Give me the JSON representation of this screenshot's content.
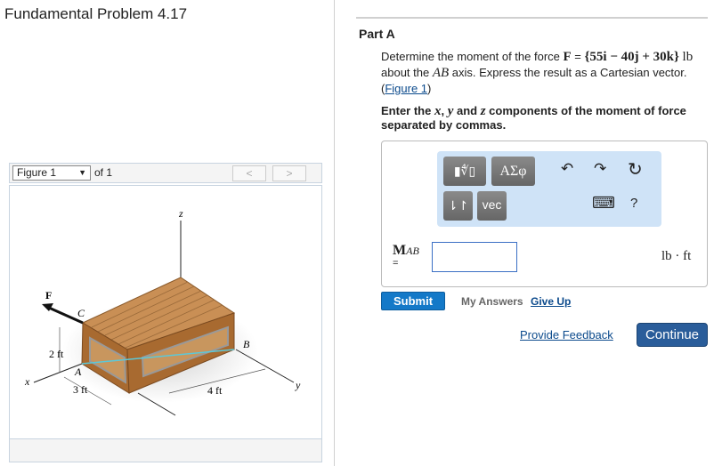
{
  "title": "Fundamental Problem 4.17",
  "figure": {
    "selected": "Figure 1",
    "of": "of 1",
    "prev": "<",
    "next": ">",
    "labels": {
      "z": "z",
      "x": "x",
      "y": "y",
      "F": "F",
      "C": "C",
      "A": "A",
      "B": "B",
      "h": "2 ft",
      "w": "3 ft",
      "l": "4 ft"
    }
  },
  "part": {
    "title": "Part A",
    "q1": "Determine the moment of the force ",
    "F": "F",
    "eq": " = ",
    "vec": "{55i − 40j + 30k}",
    "unit_lb": "lb",
    "q2": " about the ",
    "AB": "AB",
    "q3": " axis. Express the result as a Cartesian vector. ",
    "fig_link": "Figure 1",
    "instr1": "Enter the ",
    "x": "x",
    "c1": ", ",
    "y": "y",
    "c2": " and ",
    "z": "z",
    "instr2": " components of the moment of force separated by commas."
  },
  "toolbar": {
    "templates": "▮∜▯",
    "greek": "ΑΣφ",
    "arrows": "⇂↾",
    "vec": "vec",
    "undo": "↶",
    "redo": "↷",
    "reset": "↻",
    "keyboard": "⌨",
    "help": "?"
  },
  "answer": {
    "label_M": "M",
    "label_sub": "AB",
    "eq": "=",
    "value": "",
    "unit": "lb · ft"
  },
  "actions": {
    "submit": "Submit",
    "my_answers": "My Answers",
    "give_up": "Give Up",
    "feedback": "Provide Feedback",
    "continue": "Continue"
  }
}
